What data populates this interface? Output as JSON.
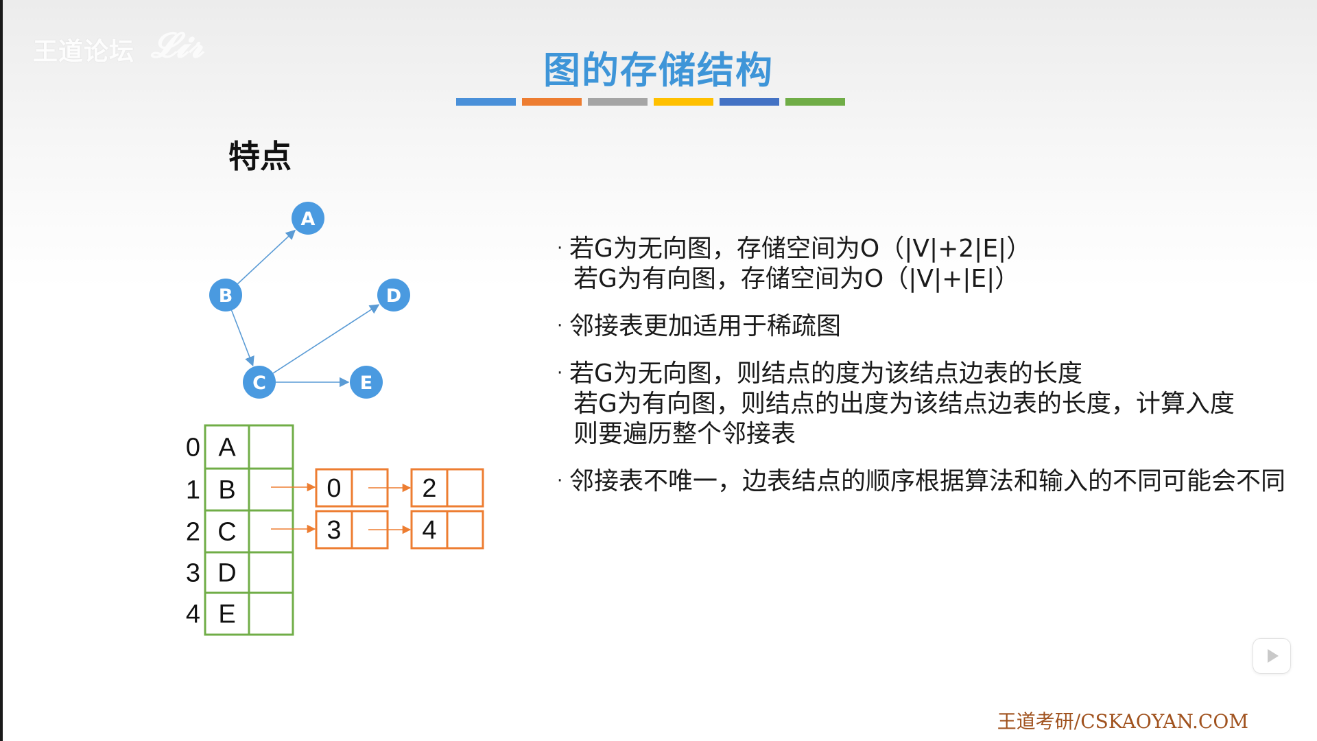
{
  "watermark": {
    "forum": "王道论坛",
    "brush": "王道考研"
  },
  "slide": {
    "title": "图的存储结构",
    "color_bar": [
      "#4a90d9",
      "#ed7d31",
      "#a5a5a5",
      "#ffc000",
      "#4472c4",
      "#70ad47"
    ],
    "section_heading": "特点"
  },
  "graph": {
    "node_color": "#4a9ae0",
    "edge_color": "#5a9bd5",
    "nodes": [
      {
        "id": "A",
        "label": "A"
      },
      {
        "id": "B",
        "label": "B"
      },
      {
        "id": "C",
        "label": "C"
      },
      {
        "id": "D",
        "label": "D"
      },
      {
        "id": "E",
        "label": "E"
      }
    ],
    "edges": [
      {
        "from": "B",
        "to": "A"
      },
      {
        "from": "B",
        "to": "C"
      },
      {
        "from": "C",
        "to": "D"
      },
      {
        "from": "C",
        "to": "E"
      }
    ]
  },
  "adjacency_table": {
    "vertex_border_color": "#70ad47",
    "edge_node_border_color": "#ed7d31",
    "rows": [
      {
        "index": "0",
        "vertex": "A",
        "edges": []
      },
      {
        "index": "1",
        "vertex": "B",
        "edges": [
          "0",
          "2"
        ]
      },
      {
        "index": "2",
        "vertex": "C",
        "edges": [
          "3",
          "4"
        ]
      },
      {
        "index": "3",
        "vertex": "D",
        "edges": []
      },
      {
        "index": "4",
        "vertex": "E",
        "edges": []
      }
    ]
  },
  "bullets": [
    {
      "lines": [
        "若G为无向图，存储空间为O（|V|+2|E|）",
        "若G为有向图，存储空间为O（|V|+|E|）"
      ]
    },
    {
      "lines": [
        "邻接表更加适用于稀疏图"
      ]
    },
    {
      "lines": [
        "若G为无向图，则结点的度为该结点边表的长度",
        "若G为有向图，则结点的出度为该结点边表的长度，计算入度则要遍历整个邻接表"
      ]
    },
    {
      "lines": [
        "邻接表不唯一，边表结点的顺序根据算法和输入的不同可能会不同"
      ]
    }
  ],
  "footer": {
    "site": "王道考研/CSKAOYAN.COM"
  }
}
